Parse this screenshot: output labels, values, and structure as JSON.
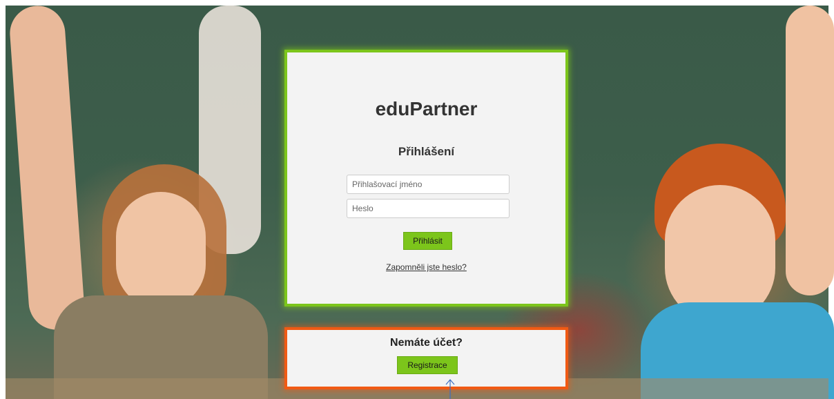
{
  "login": {
    "app_title": "eduPartner",
    "heading": "Přihlášení",
    "username_placeholder": "Přihlašovací jméno",
    "password_placeholder": "Heslo",
    "submit_label": "Přihlásit",
    "forgot_link": "Zapomněli jste heslo?"
  },
  "register": {
    "question": "Nemáte účet?",
    "button_label": "Registrace"
  },
  "colors": {
    "login_border": "#7cc51b",
    "register_border": "#f05a14",
    "button_bg": "#7cc51b",
    "panel_bg": "#f3f3f3"
  },
  "icons": {
    "pointer": "up-arrow-icon"
  }
}
